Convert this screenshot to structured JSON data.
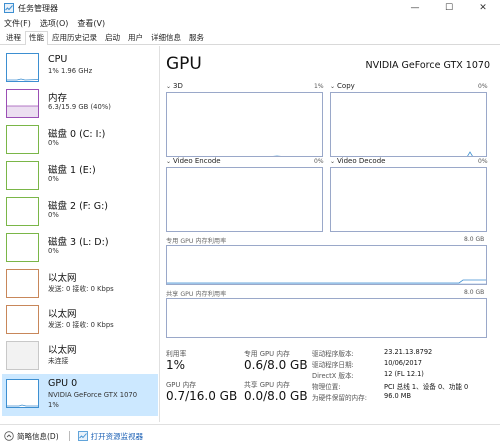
{
  "window": {
    "title": "任务管理器",
    "controls": {
      "minimize": "—",
      "maximize": "☐",
      "close": "✕"
    }
  },
  "menu": [
    "文件(F)",
    "选项(O)",
    "查看(V)"
  ],
  "tabs": [
    {
      "label": "进程",
      "active": false
    },
    {
      "label": "性能",
      "active": true
    },
    {
      "label": "应用历史记录",
      "active": false
    },
    {
      "label": "启动",
      "active": false
    },
    {
      "label": "用户",
      "active": false
    },
    {
      "label": "详细信息",
      "active": false
    },
    {
      "label": "服务",
      "active": false
    }
  ],
  "sidebar": {
    "items": [
      {
        "name": "CPU",
        "sub": "1% 1.96 GHz",
        "sub2": "",
        "color": "#3d8fd1",
        "selected": false
      },
      {
        "name": "内存",
        "sub": "6.3/15.9 GB (40%)",
        "sub2": "",
        "color": "#9b4fb5",
        "selected": false
      },
      {
        "name": "磁盘 0 (C: I:)",
        "sub": "0%",
        "sub2": "",
        "color": "#7ab648",
        "selected": false
      },
      {
        "name": "磁盘 1 (E:)",
        "sub": "0%",
        "sub2": "",
        "color": "#7ab648",
        "selected": false
      },
      {
        "name": "磁盘 2 (F: G:)",
        "sub": "0%",
        "sub2": "",
        "color": "#7ab648",
        "selected": false
      },
      {
        "name": "磁盘 3 (L: D:)",
        "sub": "0%",
        "sub2": "",
        "color": "#7ab648",
        "selected": false
      },
      {
        "name": "以太网",
        "sub": "发送: 0 接收: 0 Kbps",
        "sub2": "",
        "color": "#c8875a",
        "selected": false
      },
      {
        "name": "以太网",
        "sub": "发送: 0 接收: 0 Kbps",
        "sub2": "",
        "color": "#c8875a",
        "selected": false
      },
      {
        "name": "以太网",
        "sub": "未连接",
        "sub2": "",
        "color": "#c8c8c8",
        "selected": false
      },
      {
        "name": "GPU 0",
        "sub": "NVIDIA GeForce GTX 1070",
        "sub2": "1%",
        "color": "#3d8fd1",
        "selected": true
      }
    ]
  },
  "main": {
    "title": "GPU",
    "gpu_name": "NVIDIA GeForce GTX 1070",
    "engines": [
      {
        "label": "3D",
        "pct": "1%"
      },
      {
        "label": "Copy",
        "pct": "0%"
      },
      {
        "label": "Video Encode",
        "pct": "0%"
      },
      {
        "label": "Video Decode",
        "pct": "0%"
      }
    ],
    "dedicated": {
      "label": "专用 GPU 内存利用率",
      "max": "8.0 GB"
    },
    "shared": {
      "label": "共享 GPU 内存利用率",
      "max": "8.0 GB"
    },
    "stats": {
      "util_label": "利用率",
      "util_value": "1%",
      "ded_label": "专用 GPU 内存",
      "ded_value": "0.6/8.0 GB",
      "gpu_mem_label": "GPU 内存",
      "gpu_mem_value": "0.7/16.0 GB",
      "shared_label": "共享 GPU 内存",
      "shared_value": "0.0/8.0 GB"
    },
    "properties": [
      {
        "label": "驱动程序版本:",
        "value": "23.21.13.8792"
      },
      {
        "label": "驱动程序日期:",
        "value": "10/06/2017"
      },
      {
        "label": "DirectX 版本:",
        "value": "12 (FL 12.1)"
      },
      {
        "label": "物理位置:",
        "value": "PCI 总线 1、设备 0、功能 0"
      },
      {
        "label": "为硬件保留的内存:",
        "value": "96.0 MB"
      }
    ]
  },
  "footer": {
    "brief": "简略信息(D)",
    "monitor": "打开资源监视器"
  }
}
